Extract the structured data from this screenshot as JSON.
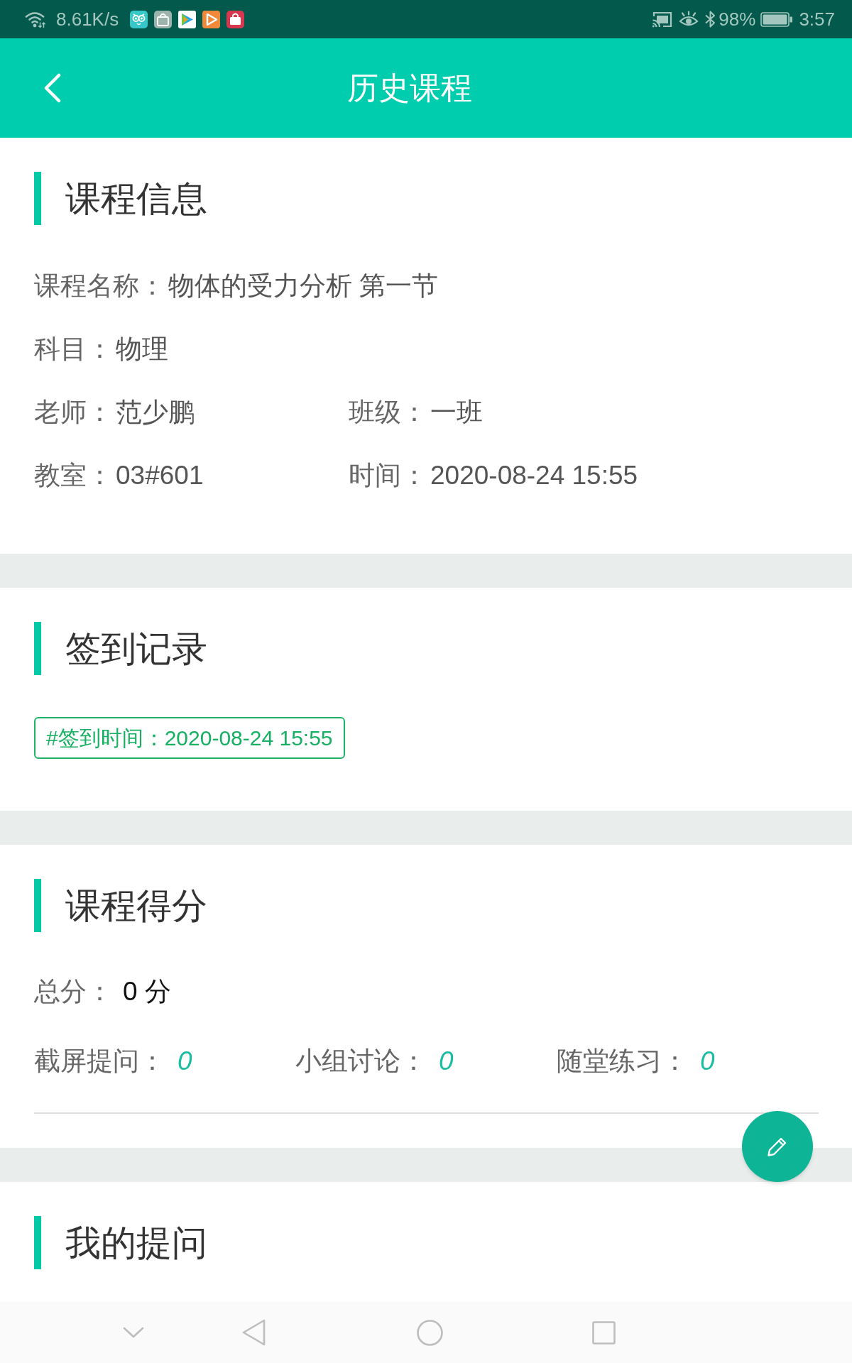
{
  "status_bar": {
    "network_speed": "8.61K/s",
    "battery": "98%",
    "time": "3:57"
  },
  "app_bar": {
    "title": "历史课程"
  },
  "sections": [
    {
      "kind": "info",
      "title": "课程信息",
      "rows": [
        [
          {
            "label": "课程名称：",
            "value": "物体的受力分析 第一节"
          }
        ],
        [
          {
            "label": "科目：",
            "value": "物理"
          }
        ],
        [
          {
            "label": "老师：",
            "value": "范少鹏"
          },
          {
            "label": "班级：",
            "value": "一班"
          }
        ],
        [
          {
            "label": "教室：",
            "value": "03#601"
          },
          {
            "label": "时间：",
            "value": "2020-08-24 15:55"
          }
        ]
      ]
    },
    {
      "kind": "checkin",
      "title": "签到记录",
      "tags": [
        "#签到时间：2020-08-24 15:55"
      ]
    },
    {
      "kind": "score",
      "title": "课程得分",
      "total": {
        "label": "总分：",
        "value": "0 分"
      },
      "items": [
        {
          "label": "截屏提问：",
          "value": "0"
        },
        {
          "label": "小组讨论：",
          "value": "0"
        },
        {
          "label": "随堂练习：",
          "value": "0"
        }
      ]
    },
    {
      "kind": "questions",
      "title": "我的提问"
    }
  ]
}
